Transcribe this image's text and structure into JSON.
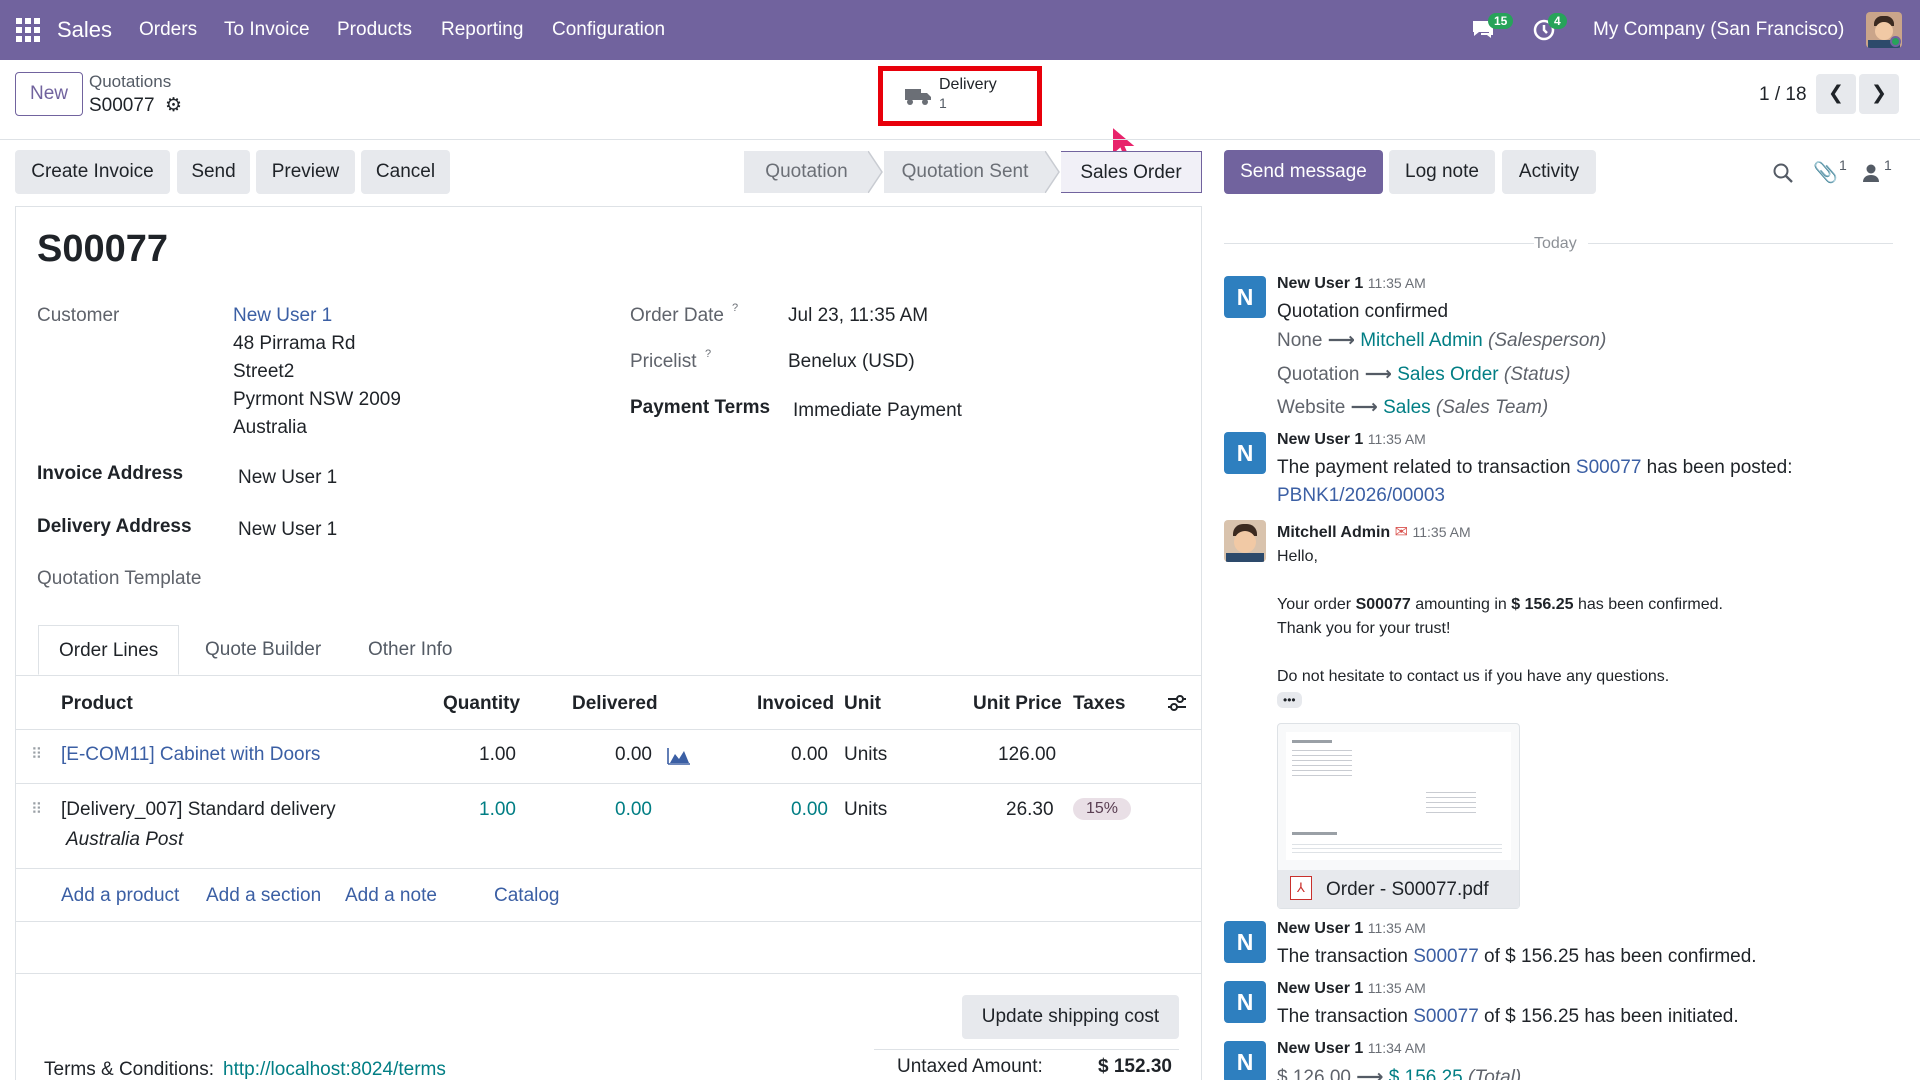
{
  "nav": {
    "app": "Sales",
    "menu": [
      "Orders",
      "To Invoice",
      "Products",
      "Reporting",
      "Configuration"
    ],
    "messages_count": "15",
    "activities_count": "4",
    "company": "My Company (San Francisco)"
  },
  "control": {
    "new_label": "New",
    "breadcrumb": "Quotations",
    "record": "S00077",
    "delivery_label": "Delivery",
    "delivery_count": "1",
    "pager": "1 / 18"
  },
  "actions": {
    "create_invoice": "Create Invoice",
    "send": "Send",
    "preview": "Preview",
    "cancel": "Cancel"
  },
  "statusbar": {
    "stages": [
      "Quotation",
      "Quotation Sent",
      "Sales Order"
    ],
    "active": "Sales Order"
  },
  "chatter_buttons": {
    "send_message": "Send message",
    "log_note": "Log note",
    "activity": "Activity",
    "attachments_count": "1",
    "followers_count": "1"
  },
  "form": {
    "title": "S00077",
    "customer_label": "Customer",
    "customer_name": "New User 1",
    "address": [
      "48 Pirrama Rd",
      "Street2",
      "Pyrmont NSW 2009",
      "Australia"
    ],
    "invoice_address_label": "Invoice Address",
    "invoice_address": "New User 1",
    "delivery_address_label": "Delivery Address",
    "delivery_address": "New User 1",
    "quotation_template_label": "Quotation Template",
    "order_date_label": "Order Date",
    "order_date": "Jul 23, 11:35 AM",
    "pricelist_label": "Pricelist",
    "pricelist": "Benelux (USD)",
    "payment_terms_label": "Payment Terms",
    "payment_terms": "Immediate Payment",
    "help_mark": "?"
  },
  "tabs": [
    "Order Lines",
    "Quote Builder",
    "Other Info"
  ],
  "table": {
    "headers": [
      "Product",
      "Quantity",
      "Delivered",
      "Invoiced",
      "Unit",
      "Unit Price",
      "Taxes"
    ],
    "rows": [
      {
        "product": "[E-COM11] Cabinet with Doors",
        "qty": "1.00",
        "delivered": "0.00",
        "invoiced": "0.00",
        "unit": "Units",
        "price": "126.00",
        "taxes": ""
      },
      {
        "product": "[Delivery_007] Standard delivery",
        "sub": "Australia Post",
        "qty": "1.00",
        "delivered": "0.00",
        "invoiced": "0.00",
        "unit": "Units",
        "price": "26.30",
        "taxes": "15%"
      }
    ],
    "add_product": "Add a product",
    "add_section": "Add a section",
    "add_note": "Add a note",
    "catalog": "Catalog"
  },
  "footer": {
    "update_shipping": "Update shipping cost",
    "terms_label": "Terms & Conditions:",
    "terms_link": "http://localhost:8024/terms",
    "untaxed_label": "Untaxed Amount:",
    "untaxed_value": "$ 152.30"
  },
  "chatter": {
    "date_sep": "Today",
    "m1": {
      "author": "New User 1",
      "time": "11:35 AM",
      "text": "Quotation confirmed",
      "changes": [
        {
          "from": "None",
          "to": "Mitchell Admin",
          "field": "(Salesperson)"
        },
        {
          "from": "Quotation",
          "to": "Sales Order",
          "field": "(Status)"
        },
        {
          "from": "Website",
          "to": "Sales",
          "field": "(Sales Team)"
        }
      ]
    },
    "m2": {
      "author": "New User 1",
      "time": "11:35 AM",
      "text_a": "The payment related to transaction ",
      "ref": "S00077",
      "text_b": " has been posted:",
      "link": "PBNK1/2026/00003"
    },
    "m3": {
      "author": "Mitchell Admin",
      "time": "11:35 AM",
      "hello": "Hello,",
      "l1a": "Your order ",
      "l1b": "S00077",
      "l1c": " amounting in ",
      "l1d": "$ 156.25",
      "l1e": " has been confirmed.",
      "l2": "Thank you for your trust!",
      "l3": "Do not hesitate to contact us if you have any questions.",
      "more": "•••",
      "attachment": "Order - S00077.pdf"
    },
    "m4": {
      "author": "New User 1",
      "time": "11:35 AM",
      "a": "The transaction ",
      "ref": "S00077",
      "b": " of $ 156.25 has been confirmed."
    },
    "m5": {
      "author": "New User 1",
      "time": "11:35 AM",
      "a": "The transaction ",
      "ref": "S00077",
      "b": " of $ 156.25 has been initiated."
    },
    "m6": {
      "author": "New User 1",
      "time": "11:34 AM",
      "from": "$ 126.00",
      "to": "$ 156.25",
      "field": "(Total)"
    },
    "avatar_letter": "N"
  }
}
